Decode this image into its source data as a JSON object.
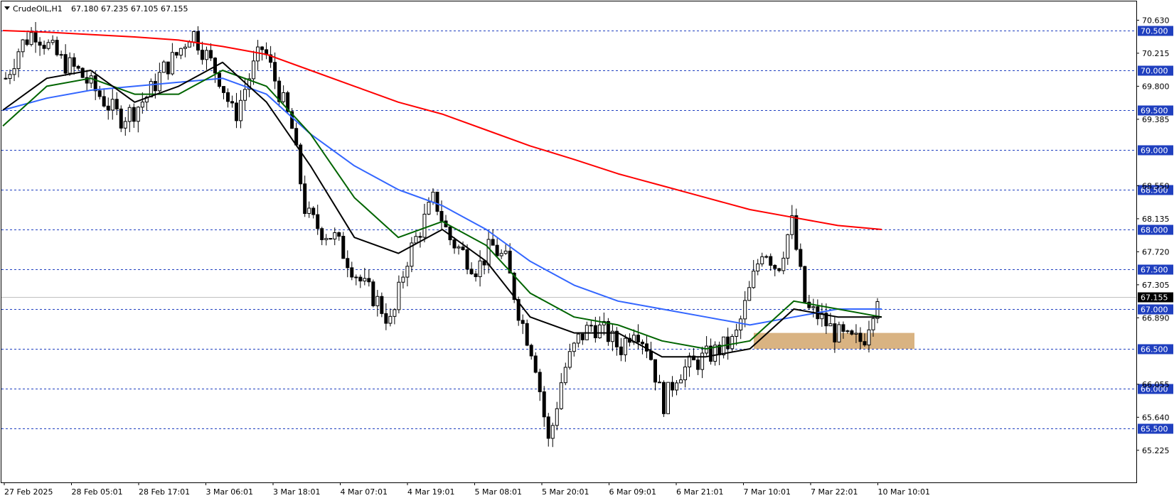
{
  "header": {
    "symbol_timeframe": "CrudeOIL,H1",
    "ohlc": "67.180 67.235 67.105 67.155"
  },
  "colors": {
    "background": "#ffffff",
    "candle": "#000000",
    "grid_dashed": "#1f3fbf",
    "level_label_bg": "#1f3fbf",
    "current_label_bg": "#000000",
    "ma_red": "#ff0000",
    "ma_blue": "#3366ff",
    "ma_green": "#006400",
    "ma_black": "#000000",
    "zone_fill": "#d9b382"
  },
  "chart_data": {
    "type": "candlestick",
    "ylim": [
      65.05,
      70.75
    ],
    "y_ticks": [
      "70.630",
      "70.215",
      "69.800",
      "69.385",
      "68.550",
      "68.135",
      "67.720",
      "67.305",
      "66.890",
      "66.055",
      "65.640",
      "65.225"
    ],
    "levels": [
      "70.500",
      "70.000",
      "69.500",
      "69.000",
      "68.500",
      "68.000",
      "67.500",
      "67.000",
      "66.500",
      "66.000",
      "65.500"
    ],
    "current_price": "67.155",
    "x_labels": [
      "27 Feb 2025",
      "28 Feb 05:01",
      "28 Feb 17:01",
      "3 Mar 06:01",
      "3 Mar 18:01",
      "4 Mar 07:01",
      "4 Mar 19:01",
      "5 Mar 08:01",
      "5 Mar 20:01",
      "6 Mar 09:01",
      "6 Mar 21:01",
      "7 Mar 10:01",
      "7 Mar 22:01",
      "10 Mar 10:01"
    ],
    "price_path": [
      69.9,
      70.3,
      70.5,
      70.3,
      70.1,
      70.0,
      69.8,
      69.6,
      69.4,
      69.5,
      69.7,
      70.0,
      70.2,
      70.5,
      70.2,
      69.9,
      69.4,
      69.9,
      70.3,
      69.8,
      69.3,
      68.2,
      68.0,
      67.9,
      67.6,
      67.3,
      67.1,
      66.8,
      67.6,
      68.0,
      68.4,
      67.9,
      67.7,
      67.5,
      67.8,
      67.6,
      66.9,
      66.4,
      65.3,
      66.2,
      66.6,
      66.8,
      66.7,
      66.5,
      66.8,
      66.5,
      65.8,
      66.2,
      66.3,
      66.4,
      66.5,
      66.6,
      67.2,
      67.8,
      67.5,
      68.1,
      67.0,
      66.9,
      66.7,
      66.6,
      66.6,
      67.2
    ],
    "ma_red": [
      70.5,
      70.48,
      70.45,
      70.42,
      70.38,
      70.3,
      70.2,
      70.0,
      69.8,
      69.6,
      69.45,
      69.25,
      69.05,
      68.88,
      68.7,
      68.55,
      68.4,
      68.25,
      68.15,
      68.05,
      68.0
    ],
    "ma_blue": [
      69.5,
      69.65,
      69.75,
      69.8,
      69.85,
      69.9,
      69.7,
      69.2,
      68.8,
      68.5,
      68.3,
      68.0,
      67.6,
      67.3,
      67.1,
      67.0,
      66.9,
      66.8,
      66.9,
      67.0,
      67.0
    ],
    "ma_green": [
      69.3,
      69.8,
      69.9,
      69.7,
      69.7,
      70.0,
      69.8,
      69.2,
      68.4,
      67.9,
      68.1,
      67.8,
      67.2,
      66.9,
      66.8,
      66.6,
      66.5,
      66.6,
      67.1,
      67.0,
      66.9
    ],
    "ma_black": [
      69.5,
      69.9,
      70.0,
      69.6,
      69.8,
      70.1,
      69.6,
      68.8,
      67.9,
      67.7,
      68.0,
      67.6,
      66.9,
      66.7,
      66.7,
      66.4,
      66.4,
      66.5,
      67.0,
      66.9,
      66.9
    ],
    "support_zone": [
      66.5,
      66.7
    ]
  }
}
